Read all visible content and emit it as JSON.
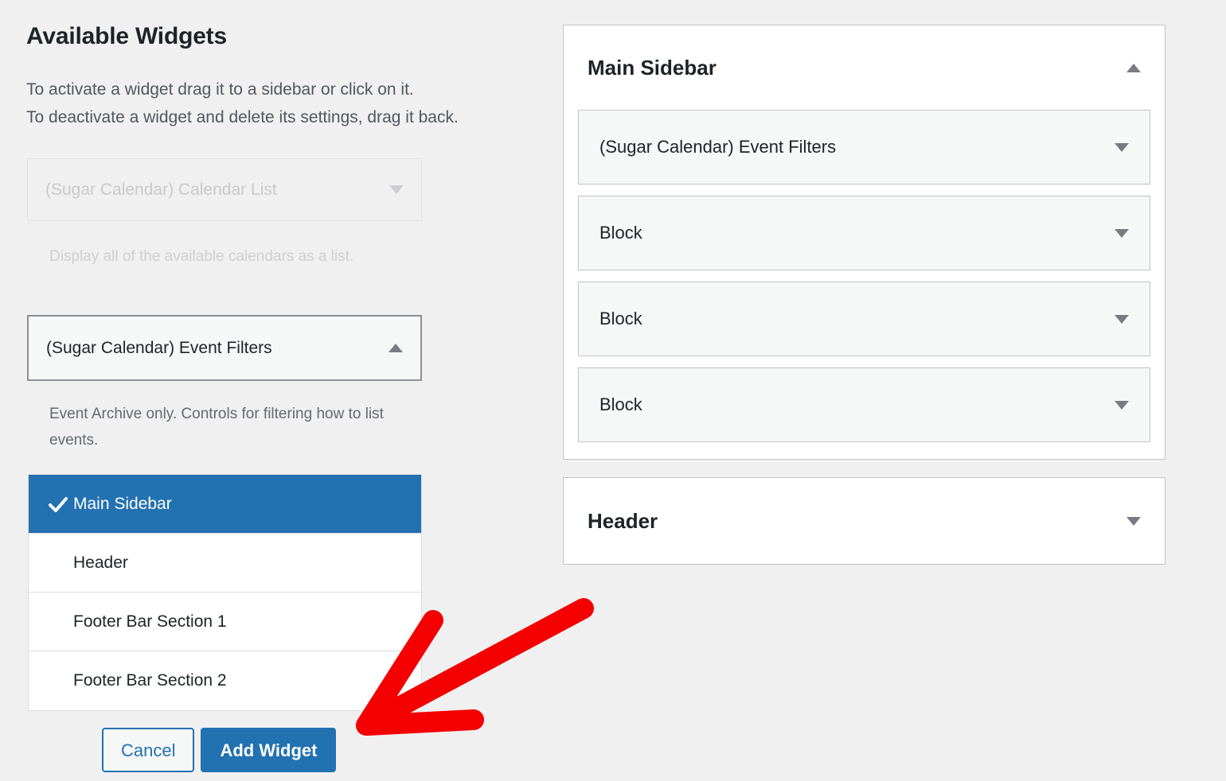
{
  "page": {
    "title": "Available Widgets",
    "intro_line1": "To activate a widget drag it to a sidebar or click on it.",
    "intro_line2": "To deactivate a widget and delete its settings, drag it back."
  },
  "available_widgets": [
    {
      "label": "(Sugar Calendar) Calendar List",
      "description": "Display all of the available calendars as a list.",
      "state": "disabled",
      "toggle_icon": "chevron-down-icon"
    },
    {
      "label": "(Sugar Calendar) Event Filters",
      "description": "Event Archive only. Controls for filtering how to list events.",
      "state": "expanded",
      "toggle_icon": "chevron-up-icon"
    }
  ],
  "sidebar_select": {
    "name": "sidebar-target-select",
    "selected": "Main Sidebar",
    "options": [
      {
        "label": "Main Sidebar",
        "selected": true
      },
      {
        "label": "Header",
        "selected": false
      },
      {
        "label": "Footer Bar Section 1",
        "selected": false
      },
      {
        "label": "Footer Bar Section 2",
        "selected": false
      }
    ]
  },
  "buttons": {
    "cancel_label": "Cancel",
    "add_widget_label": "Add Widget"
  },
  "panels": [
    {
      "title": "Main Sidebar",
      "toggle_icon": "chevron-up-icon",
      "expanded": true,
      "widgets": [
        {
          "label": "(Sugar Calendar) Event Filters",
          "toggle_icon": "chevron-down-icon"
        },
        {
          "label": "Block",
          "toggle_icon": "chevron-down-icon"
        },
        {
          "label": "Block",
          "toggle_icon": "chevron-down-icon"
        },
        {
          "label": "Block",
          "toggle_icon": "chevron-down-icon"
        }
      ]
    },
    {
      "title": "Header",
      "toggle_icon": "chevron-down-icon",
      "expanded": false,
      "widgets": []
    }
  ],
  "annotation": {
    "type": "arrow",
    "color": "#f50000",
    "points_to": "add-widget-button"
  },
  "colors": {
    "accent_blue": "#2271b1",
    "page_bg": "#f0f0f1",
    "panel_bg": "#ffffff",
    "tile_bg": "#f6f7f7",
    "border": "#c3c4c7",
    "text_dark": "#1d2327",
    "text_muted": "#646970",
    "annotation_red": "#f50000"
  }
}
